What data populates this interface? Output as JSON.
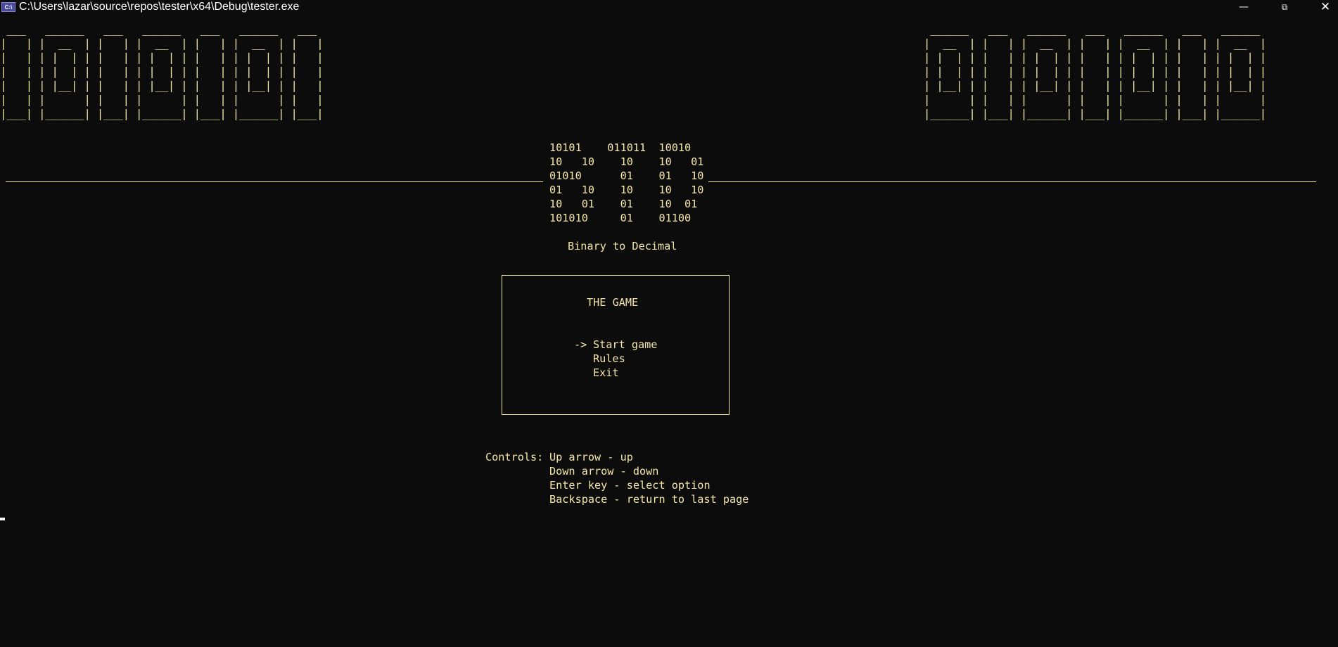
{
  "window": {
    "title": "C:\\Users\\lazar\\source\\repos\\tester\\x64\\Debug\\tester.exe",
    "icon_text": "C:\\"
  },
  "banner_left": [
    " ___   ______   ___   ______   ___   ______   ___",
    "|   | |  __  | |   | |  __  | |   | |  __  | |   |",
    "|   | | |  | | |   | | |  | | |   | | |  | | |   |",
    "|   | | |  | | |   | | |  | | |   | | |  | | |   |",
    "|   | | |__| | |   | | |__| | |   | | |__| | |   |",
    "|   | |      | |   | |      | |   | |      | |   |",
    "|___| |______| |___| |______| |___| |______| |___|"
  ],
  "banner_right": [
    " ______   ___   ______   ___   ______   ___   ______",
    "|  __  | |   | |  __  | |   | |  __  | |   | |  __  |",
    "| |  | | |   | | |  | | |   | | |  | | |   | | |  | |",
    "| |  | | |   | | |  | | |   | | |  | | |   | | |  | |",
    "| |__| | |   | | |__| | |   | | |__| | |   | | |__| |",
    "|      | |   | |      | |   | |      | |   | |      |",
    "|______| |___| |______| |___| |______| |___| |______|"
  ],
  "logo_lines": [
    "10101    011011  10010",
    "10   10    10    10   01",
    "01010      01    01   10",
    "01   10    10    10   10",
    "10   01    01    10  01",
    "101010     01    01100"
  ],
  "subtitle": "Binary to Decimal",
  "menu": {
    "title": "THE GAME",
    "pointer": "->",
    "items": [
      "Start game",
      "Rules",
      "Exit"
    ],
    "selected_index": 0
  },
  "controls": {
    "label": "Controls:",
    "lines": [
      "Up arrow - up",
      "Down arrow - down",
      "Enter key - select option",
      "Backspace - return to last page"
    ]
  },
  "colors": {
    "background": "#0c0c0c",
    "text": "#f5e6a7",
    "titlebar_text": "#ffffff"
  }
}
